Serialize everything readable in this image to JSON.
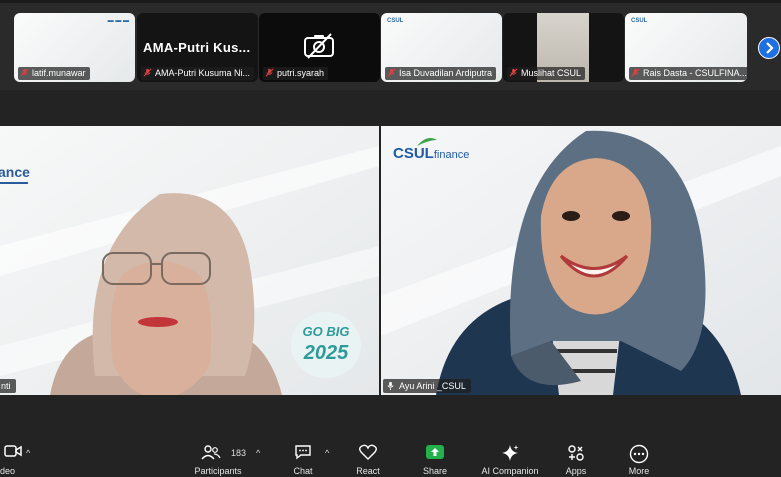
{
  "participants_strip": {
    "tiles": [
      {
        "name": "latif.munawar",
        "muted": true
      },
      {
        "name": "AMA-Putri Kusuma Ni...",
        "display_text": "AMA-Putri  Kus...",
        "muted": true
      },
      {
        "name": "putri.syarah",
        "muted": true,
        "camera_off": true
      },
      {
        "name": "Isa Duvadilan Ardiputra",
        "muted": true
      },
      {
        "name": "Muslihat CSUL",
        "muted": true
      },
      {
        "name": "Rais Dasta - CSULFINA...",
        "muted": true
      }
    ],
    "next_icon": "chevron-right-icon"
  },
  "videos": {
    "left": {
      "name_partial": "nti",
      "logo_text": "ance",
      "badge_top": "GO BIG",
      "badge_bottom": "2025"
    },
    "right": {
      "name": "Ayu Arini _CSUL",
      "logo_text": "CSUL",
      "logo_suffix": "finance",
      "active_speaker": true
    }
  },
  "toolbar": {
    "video_label": "deo",
    "participants_label": "Participants",
    "participants_count": "183",
    "chat_label": "Chat",
    "react_label": "React",
    "share_label": "Share",
    "ai_label": "AI Companion",
    "apps_label": "Apps",
    "more_label": "More"
  },
  "colors": {
    "active_speaker_border": "#2ecf5f",
    "share_green": "#24b04a",
    "next_button": "#1f6fe0"
  }
}
